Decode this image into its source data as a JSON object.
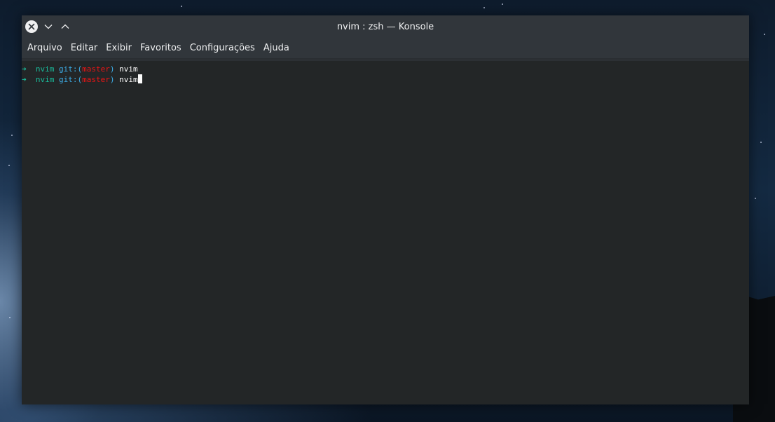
{
  "window": {
    "title": "nvim : zsh — Konsole"
  },
  "titlebar_buttons": {
    "close_icon": "close-icon",
    "minimize_icon": "chevron-down-icon",
    "maximize_icon": "chevron-up-icon"
  },
  "menu": {
    "items": [
      {
        "label": "Arquivo"
      },
      {
        "label": "Editar"
      },
      {
        "label": "Exibir"
      },
      {
        "label": "Favoritos"
      },
      {
        "label": "Configurações"
      },
      {
        "label": "Ajuda"
      }
    ]
  },
  "terminal": {
    "lines": [
      {
        "arrow": "➜",
        "dir": "nvim",
        "git_prefix": "git:(",
        "branch": "master",
        "git_suffix": ")",
        "command": "nvim"
      },
      {
        "arrow": "➜",
        "dir": "nvim",
        "git_prefix": "git:(",
        "branch": "master",
        "git_suffix": ")",
        "command": "nvim"
      }
    ]
  },
  "colors": {
    "prompt_arrow": "#1abc9c",
    "directory": "#1abc9c",
    "git": "#3daee9",
    "branch": "#ed1515",
    "terminal_bg": "#232627",
    "chrome_bg": "#31363b"
  }
}
